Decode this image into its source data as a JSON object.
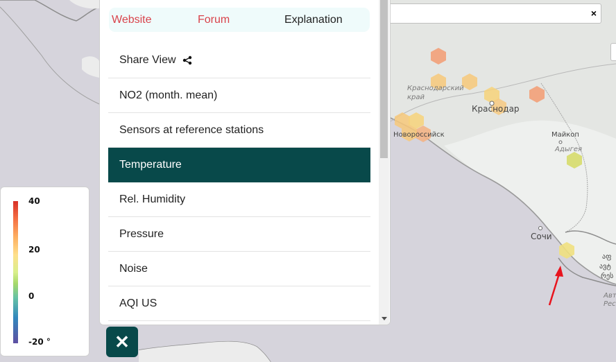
{
  "tabs": [
    {
      "label": "Website"
    },
    {
      "label": "Forum"
    },
    {
      "label": "Explanation"
    }
  ],
  "menu": {
    "items": [
      {
        "label": "Share View"
      },
      {
        "label": "NO2 (month. mean)"
      },
      {
        "label": "Sensors at reference stations"
      },
      {
        "label": "Temperature"
      },
      {
        "label": "Rel. Humidity"
      },
      {
        "label": "Pressure"
      },
      {
        "label": "Noise"
      },
      {
        "label": "AQI US"
      }
    ],
    "active_index": 3
  },
  "legend": {
    "ticks": [
      "40",
      "20",
      "0",
      "-20 °"
    ]
  },
  "search": {
    "close_glyph": "×"
  },
  "close_button": {
    "glyph": "✕"
  },
  "map_labels": {
    "krasnodar_region_line1": "Краснодарский",
    "krasnodar_region_line2": "край",
    "krasnodar": "Краснодар",
    "novorossiysk": "Новороссийск",
    "maykop": "Майкоп",
    "adygea": "Адыгея",
    "sochi": "Сочи",
    "right_edge_1": "აფ",
    "right_edge_2": "ავტ",
    "right_edge_3": "რეს",
    "right_edge_4": "Авт",
    "right_edge_5": "Рес"
  },
  "colors": {
    "accent": "#08494a",
    "tab_link": "#d9434b",
    "tab_bg": "#effbfb",
    "map_bg": "#d6d4dc",
    "hex_orange": "#f2a078",
    "hex_yellow": "#f7d27a",
    "hex_green": "#d6dc6a",
    "arrow_red": "#e8141e"
  }
}
